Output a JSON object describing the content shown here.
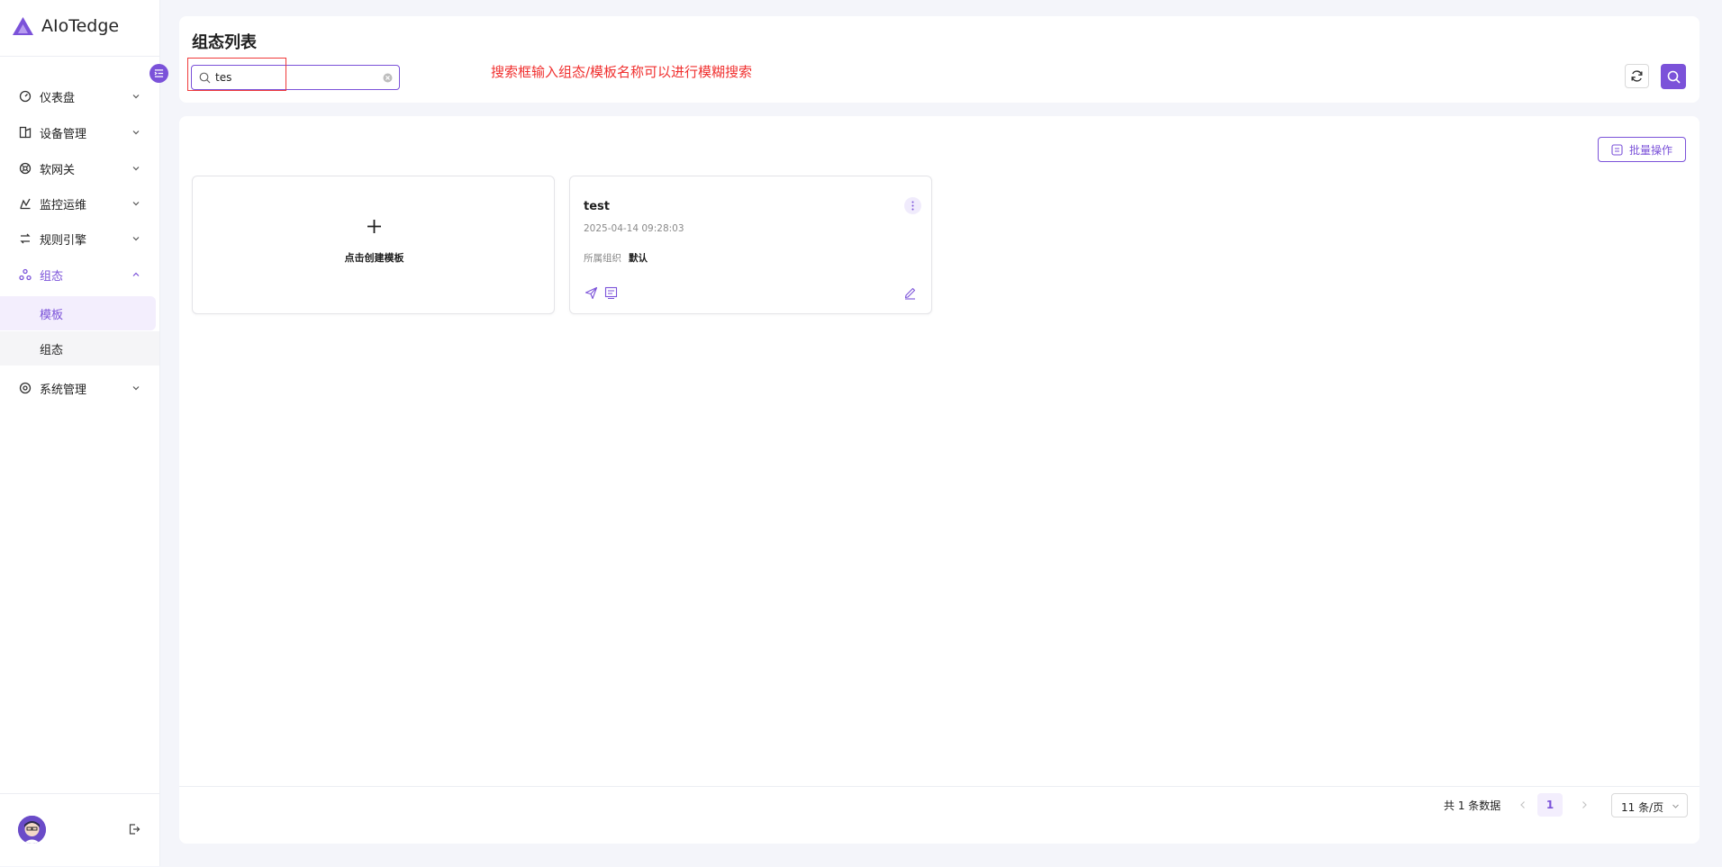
{
  "app": {
    "name": "AIoTedge"
  },
  "sidebar": {
    "items": [
      {
        "label": "仪表盘",
        "icon": "dashboard-icon"
      },
      {
        "label": "设备管理",
        "icon": "device-icon"
      },
      {
        "label": "软网关",
        "icon": "gateway-icon"
      },
      {
        "label": "监控运维",
        "icon": "monitor-icon"
      },
      {
        "label": "规则引擎",
        "icon": "rule-icon"
      },
      {
        "label": "组态",
        "icon": "configuration-icon",
        "expanded": true,
        "children": [
          {
            "label": "模板",
            "active": true
          },
          {
            "label": "组态"
          }
        ]
      },
      {
        "label": "系统管理",
        "icon": "settings-icon"
      }
    ]
  },
  "header": {
    "title": "组态列表",
    "search": {
      "value": "tes",
      "placeholder": ""
    },
    "annotation": "搜索框输入组态/模板名称可以进行模糊搜索"
  },
  "toolbar": {
    "batch_label": "批量操作"
  },
  "create_card": {
    "label": "点击创建模板"
  },
  "templates": [
    {
      "name": "test",
      "date": "2025-04-14 09:28:03",
      "org_label": "所属组织",
      "org_value": "默认"
    }
  ],
  "pagination": {
    "total_text": "共 1 条数据",
    "current_page": "1",
    "page_size": "11 条/页"
  },
  "colors": {
    "accent": "#7b52d9",
    "annotation": "#f0302f",
    "active_bg": "#f3eefd"
  }
}
